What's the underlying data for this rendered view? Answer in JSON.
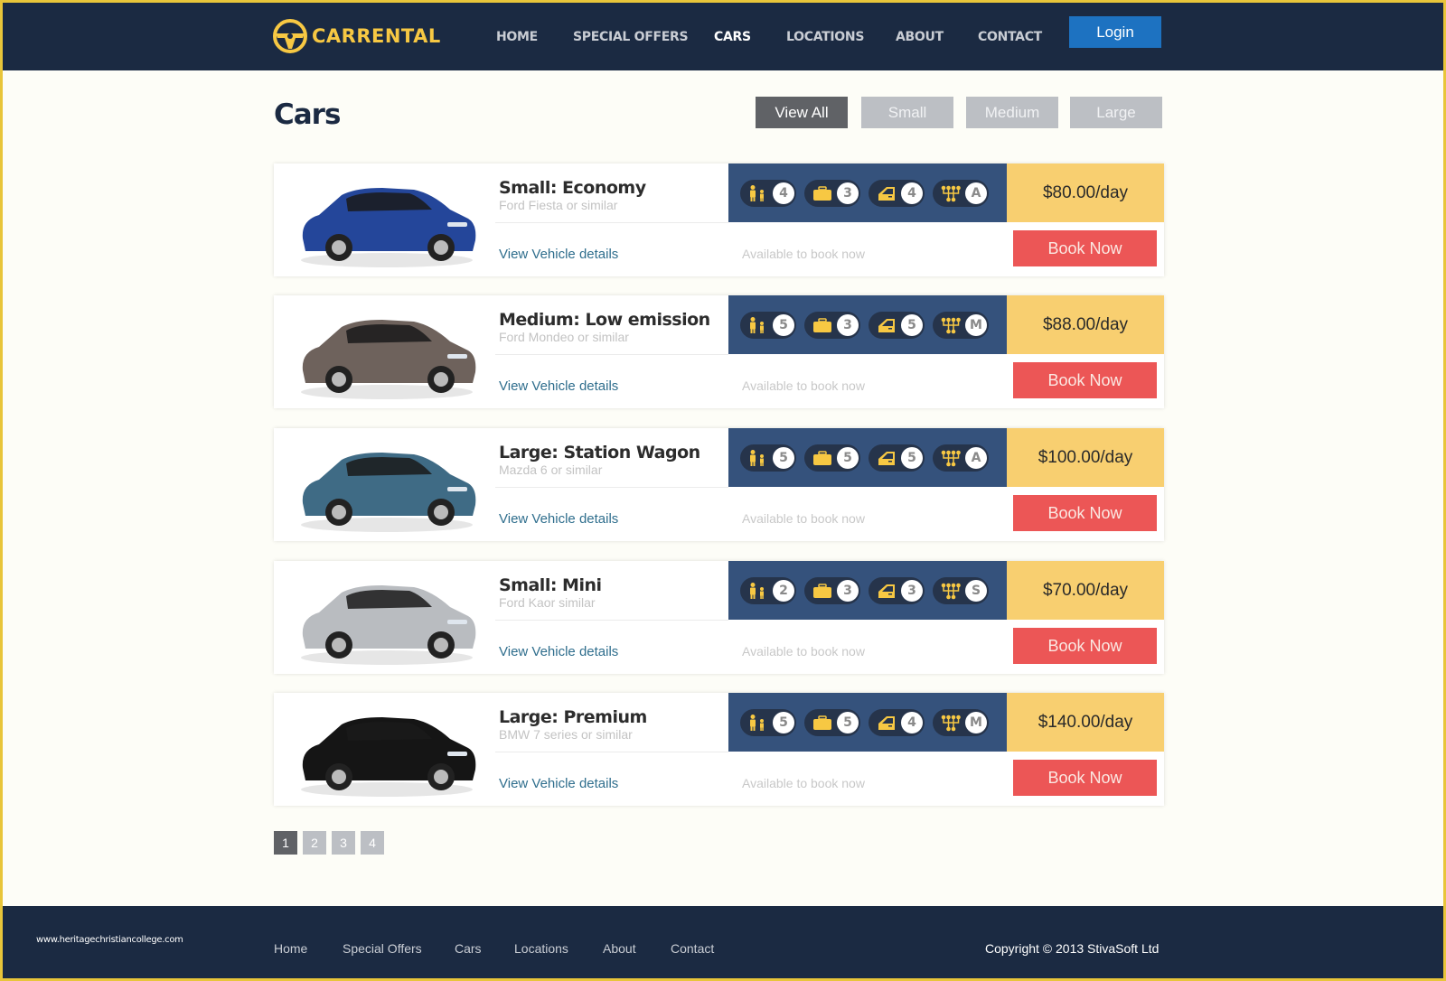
{
  "header": {
    "brand": "CARRENTAL",
    "nav": [
      {
        "label": "HOME",
        "active": false
      },
      {
        "label": "SPECIAL OFFERS",
        "active": false
      },
      {
        "label": "CARS",
        "active": true
      },
      {
        "label": "LOCATIONS",
        "active": false
      },
      {
        "label": "ABOUT",
        "active": false
      },
      {
        "label": "CONTACT",
        "active": false
      }
    ],
    "login_label": "Login"
  },
  "page": {
    "title": "Cars",
    "filters": [
      {
        "label": "View All",
        "active": true
      },
      {
        "label": "Small",
        "active": false
      },
      {
        "label": "Medium",
        "active": false
      },
      {
        "label": "Large",
        "active": false
      }
    ]
  },
  "cars": [
    {
      "name": "Small: Economy",
      "model": "Ford Fiesta or similar",
      "details_link": "View Vehicle details",
      "availability": "Available to book now",
      "passengers": "4",
      "luggage": "3",
      "doors": "4",
      "transmission": "A",
      "price": "$80.00/day",
      "book_label": "Book Now",
      "image": "car-blue-hatchback",
      "color": "#24469a"
    },
    {
      "name": "Medium: Low emission",
      "model": "Ford Mondeo or similar",
      "details_link": "View Vehicle details",
      "availability": "Available to book now",
      "passengers": "5",
      "luggage": "3",
      "doors": "5",
      "transmission": "M",
      "price": "$88.00/day",
      "book_label": "Book Now",
      "image": "car-brown-sedan",
      "color": "#6e625c"
    },
    {
      "name": "Large: Station Wagon",
      "model": "Mazda 6 or similar",
      "details_link": "View Vehicle details",
      "availability": "Available to book now",
      "passengers": "5",
      "luggage": "5",
      "doors": "5",
      "transmission": "A",
      "price": "$100.00/day",
      "book_label": "Book Now",
      "image": "car-teal-sedan",
      "color": "#3f6b85"
    },
    {
      "name": "Small: Mini",
      "model": "Ford Kaor similar",
      "details_link": "View Vehicle details",
      "availability": "Available to book now",
      "passengers": "2",
      "luggage": "3",
      "doors": "3",
      "transmission": "S",
      "price": "$70.00/day",
      "book_label": "Book Now",
      "image": "car-silver-mini",
      "color": "#b9bcc0"
    },
    {
      "name": "Large: Premium",
      "model": "BMW 7 series or similar",
      "details_link": "View Vehicle details",
      "availability": "Available to book now",
      "passengers": "5",
      "luggage": "5",
      "doors": "4",
      "transmission": "M",
      "price": "$140.00/day",
      "book_label": "Book Now",
      "image": "car-black-luxury",
      "color": "#151515"
    }
  ],
  "pagination": [
    {
      "label": "1",
      "active": true
    },
    {
      "label": "2",
      "active": false
    },
    {
      "label": "3",
      "active": false
    },
    {
      "label": "4",
      "active": false
    }
  ],
  "footer": {
    "watermark": "www.heritagechristiancollege.com",
    "links": [
      "Home",
      "Special Offers",
      "Cars",
      "Locations",
      "About",
      "Contact"
    ],
    "copyright": "Copyright © 2013 StivaSoft Ltd"
  },
  "colors": {
    "navy": "#1b2a42",
    "brand_yellow": "#f7c843",
    "login_blue": "#1d72c1",
    "spec_blue": "#35527c",
    "price_yellow": "#f8cf70",
    "book_red": "#ec5656",
    "link_teal": "#2f6e8d"
  }
}
